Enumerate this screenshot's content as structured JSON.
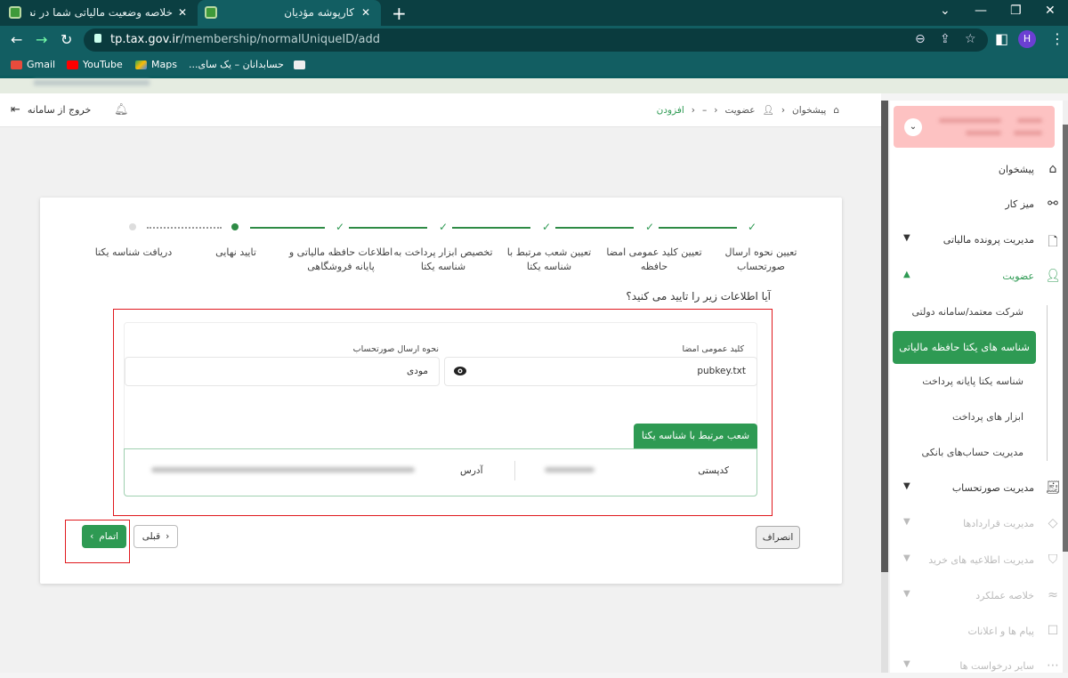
{
  "browser": {
    "tabs": [
      {
        "title": "خلاصه وضعیت مالیاتی شما در نظا",
        "active": false
      },
      {
        "title": "کارپوشه مؤدیان",
        "active": true
      }
    ],
    "url_host": "tp.tax.gov.ir",
    "url_path": "/membership/normalUniqueID/add",
    "profile_initial": "H",
    "bookmarks": [
      {
        "label": "Gmail",
        "icon": "gmail-icon"
      },
      {
        "label": "YouTube",
        "icon": "youtube-icon"
      },
      {
        "label": "Maps",
        "icon": "maps-icon"
      },
      {
        "label": "حسابدانان – یک سای...",
        "icon": "site-icon"
      }
    ]
  },
  "topbar": {
    "logout_label": "خروج از سامانه",
    "breadcrumb": [
      {
        "label": "پیشخوان",
        "icon": "home-icon"
      },
      {
        "label": "عضویت",
        "icon": "user-icon"
      },
      {
        "label": "–"
      },
      {
        "label": "افزودن",
        "active": true
      }
    ]
  },
  "stepper": {
    "steps": [
      {
        "label": "تعیین نحوه ارسال صورتحساب",
        "status": "done"
      },
      {
        "label": "تعیین کلید عمومی امضا حافظه",
        "status": "done"
      },
      {
        "label": "تعیین شعب مرتبط با شناسه یکتا",
        "status": "done"
      },
      {
        "label": "تخصیص ابزار پرداخت به شناسه یکتا",
        "status": "done"
      },
      {
        "label": "اطلاعات حافظه مالیاتی و پایانه فروشگاهی",
        "status": "done"
      },
      {
        "label": "تایید نهایی",
        "status": "current"
      },
      {
        "label": "دریافت شناسه یکتا",
        "status": "pending"
      }
    ]
  },
  "form": {
    "question": "آیا اطلاعات زیر را تایید می کنید؟",
    "public_key_label": "کلید عمومی امضا",
    "public_key_value": "pubkey.txt",
    "invoice_method_label": "نحوه ارسال صورتحساب",
    "invoice_method_value": "مودی",
    "branch_tab_label": "شعب مرتبط با شناسه یکتا",
    "postal_code_label": "کدپستی",
    "address_label": "آدرس"
  },
  "buttons": {
    "finish": "اتمام",
    "previous": "قبلی",
    "cancel": "انصراف"
  },
  "sidebar": {
    "items": [
      {
        "label": "پیشخوان",
        "icon": "home-icon"
      },
      {
        "label": "میز کار",
        "icon": "workspace-icon"
      },
      {
        "label": "مدیریت پرونده مالیاتی",
        "icon": "file-icon",
        "expandable": true
      },
      {
        "label": "عضویت",
        "icon": "user-icon",
        "expandable": true,
        "open": true
      },
      {
        "label": "مدیریت صورتحساب",
        "icon": "invoice-icon",
        "expandable": true
      },
      {
        "label": "مدیریت قراردادها",
        "icon": "handshake-icon",
        "expandable": true,
        "disabled": true
      },
      {
        "label": "مدیریت اطلاعیه های خرید",
        "icon": "bag-icon",
        "expandable": true,
        "disabled": true
      },
      {
        "label": "خلاصه عملکرد",
        "icon": "chart-icon",
        "expandable": true,
        "disabled": true
      },
      {
        "label": "پیام ها و اعلانات",
        "icon": "message-icon",
        "disabled": true
      },
      {
        "label": "سایر درخواست ها",
        "icon": "request-icon",
        "expandable": true,
        "disabled": true
      }
    ],
    "membership_sub": [
      {
        "label": "شرکت معتمد/سامانه دولتی"
      },
      {
        "label": "شناسه های یکتا حافظه مالیاتی",
        "active": true
      },
      {
        "label": "شناسه یکتا پایانه پرداخت"
      },
      {
        "label": "ابزار های پرداخت"
      },
      {
        "label": "مدیریت حساب‌های بانکی"
      }
    ]
  },
  "colors": {
    "accent": "#2e9a53",
    "highlight_border": "#e0191e",
    "chrome": "#125e62"
  }
}
